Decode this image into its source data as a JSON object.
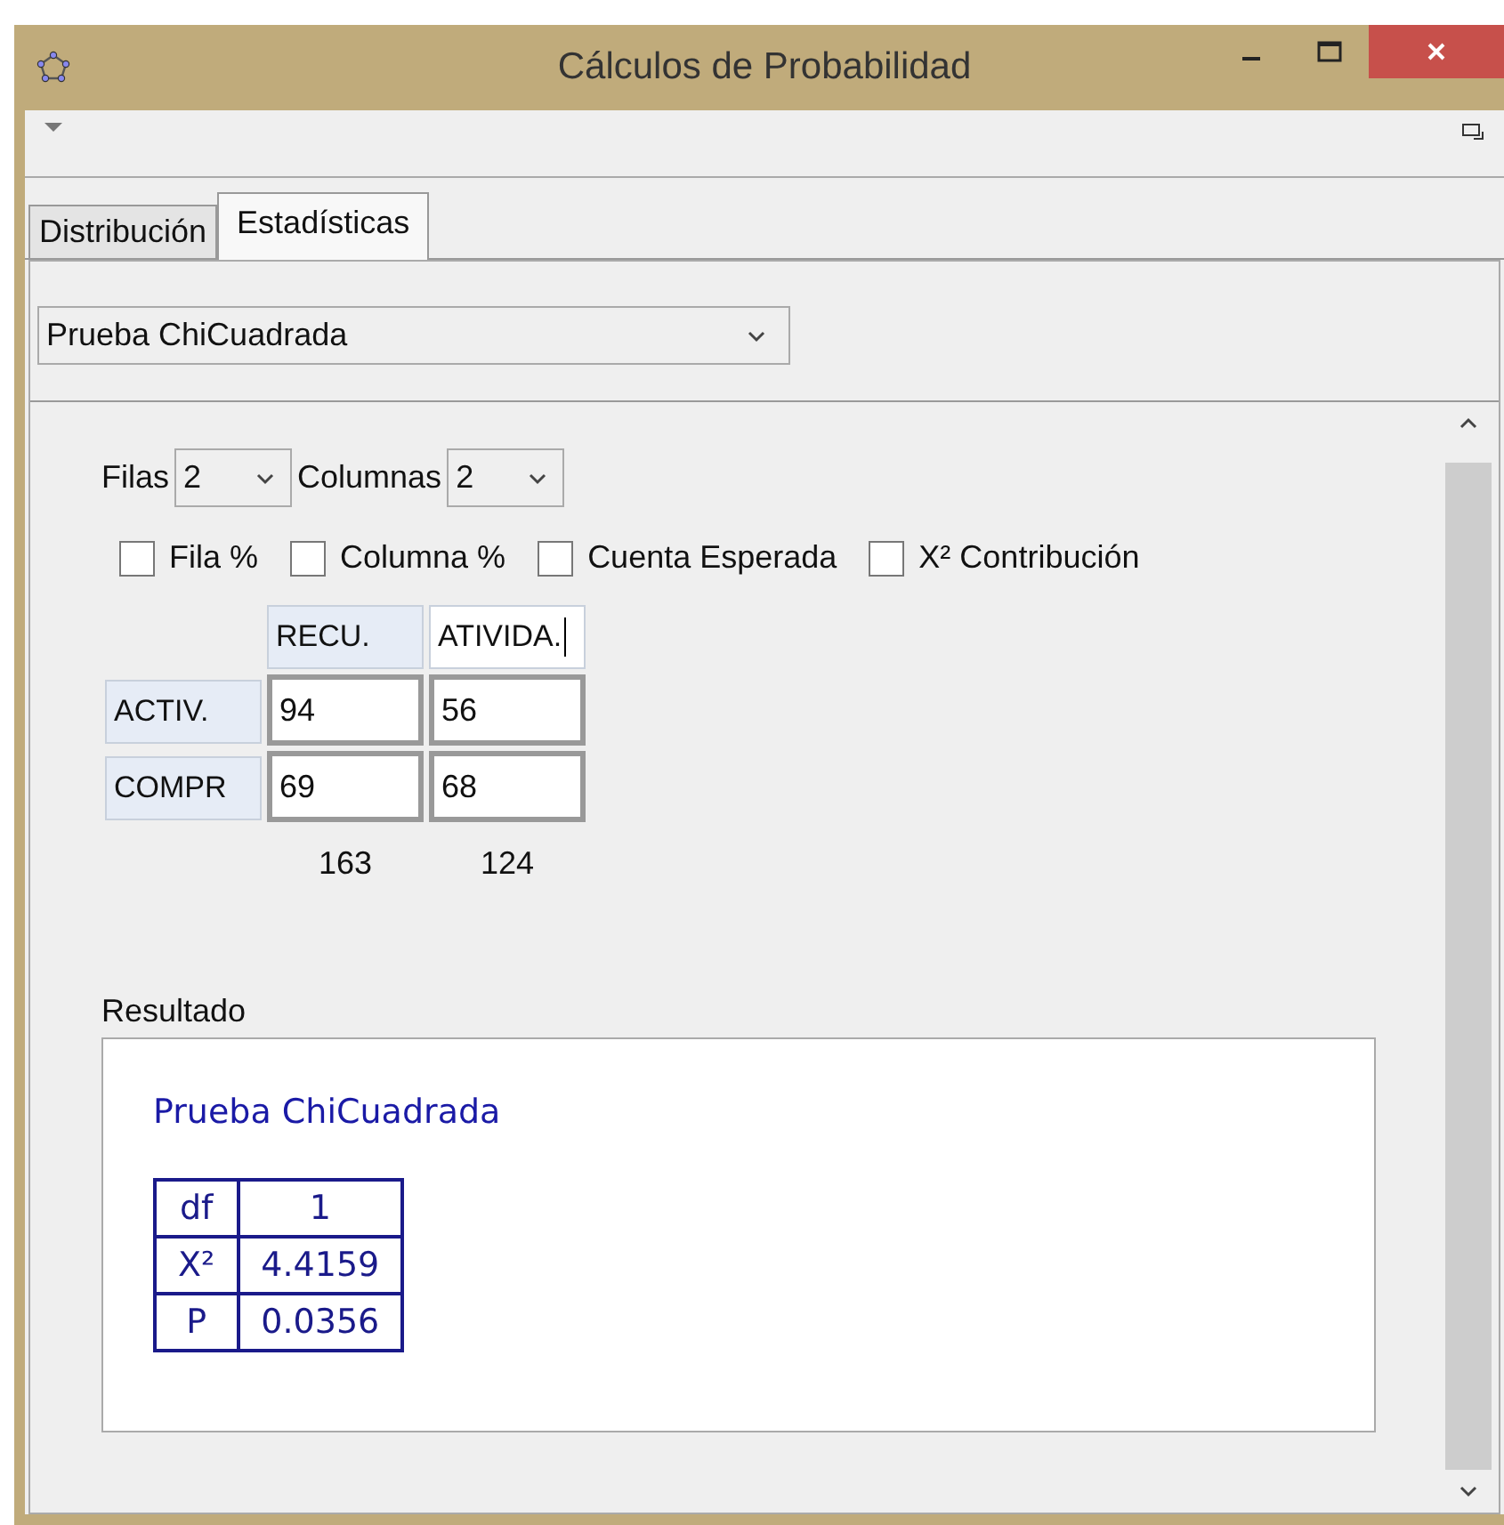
{
  "window": {
    "title": "Cálculos de Probabilidad"
  },
  "tabs": [
    {
      "label": "Distribución",
      "selected": false
    },
    {
      "label": "Estadísticas",
      "selected": true
    }
  ],
  "procedure": {
    "value": "Prueba ChiCuadrada"
  },
  "rows_select": {
    "label": "Filas",
    "value": "2"
  },
  "columns_select": {
    "label": "Columnas",
    "value": "2"
  },
  "options": [
    {
      "label": "Fila %",
      "checked": false
    },
    {
      "label": "Columna %",
      "checked": false
    },
    {
      "label": "Cuenta Esperada",
      "checked": false
    },
    {
      "label": "X² Contribución",
      "checked": false
    }
  ],
  "column_headers": [
    {
      "text": "RECU.",
      "editing": false
    },
    {
      "text": "ATIVIDA.",
      "editing": true
    }
  ],
  "rows": [
    {
      "header": "ACTIV.",
      "cells": [
        "94",
        "56"
      ]
    },
    {
      "header": "COMPR",
      "cells": [
        "69",
        "68"
      ]
    }
  ],
  "column_totals": [
    "163",
    "124"
  ],
  "result": {
    "label": "Resultado",
    "title": "Prueba ChiCuadrada",
    "table": [
      {
        "name": "df",
        "value": "1"
      },
      {
        "name": "X²",
        "value": "4.4159"
      },
      {
        "name": "P",
        "value": "0.0356"
      }
    ]
  }
}
